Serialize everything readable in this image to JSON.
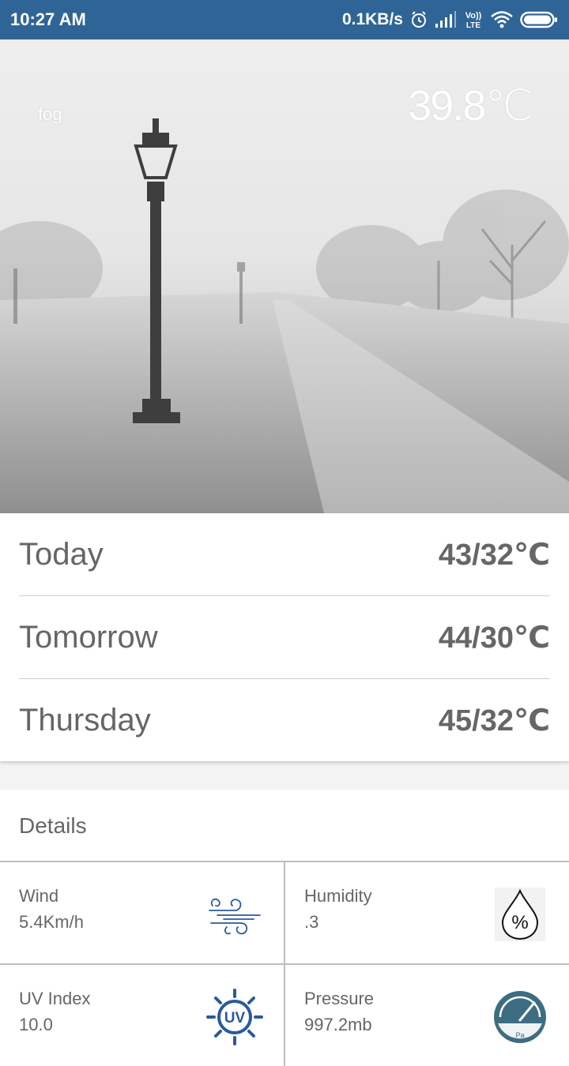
{
  "status_bar": {
    "time": "10:27 AM",
    "net_speed": "0.1KB/s",
    "icons": [
      "alarm-icon",
      "signal-icon",
      "volte-icon",
      "wifi-icon",
      "battery-icon"
    ],
    "volte_label_top": "Vo))",
    "volte_label_bottom": "LTE"
  },
  "current": {
    "condition": "fog",
    "temperature": "39.8℃"
  },
  "forecast": [
    {
      "day": "Today",
      "temp": "43/32℃"
    },
    {
      "day": "Tomorrow",
      "temp": "44/30℃"
    },
    {
      "day": "Thursday",
      "temp": "45/32℃"
    }
  ],
  "details": {
    "title": "Details",
    "items": [
      {
        "label": "Wind",
        "value": "5.4Km/h",
        "icon": "wind-icon"
      },
      {
        "label": "Humidity",
        "value": ".3",
        "icon": "humidity-icon"
      },
      {
        "label": "UV Index",
        "value": "10.0",
        "icon": "uv-icon"
      },
      {
        "label": "Pressure",
        "value": "997.2mb",
        "icon": "pressure-gauge-icon"
      }
    ],
    "uv_icon_text": "UV",
    "pressure_icon_text": "Pa",
    "humidity_icon_text": "%"
  },
  "colors": {
    "status_bar": "#2f6596",
    "text_gray": "#666666",
    "icon_blue": "#2a5a9a",
    "gauge_teal": "#3e6d82"
  }
}
